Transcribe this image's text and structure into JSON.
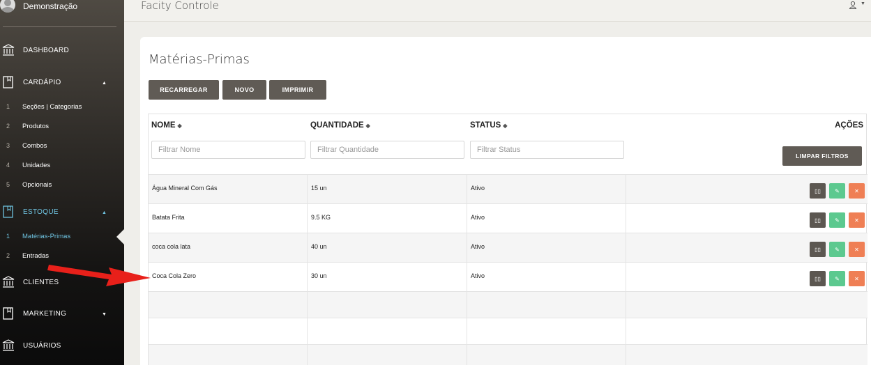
{
  "profile": {
    "name": "Demonstração"
  },
  "topbar": {
    "title": "Facity Controle",
    "user_icon": "user-icon"
  },
  "sidebar": {
    "items": [
      {
        "label": "DASHBOARD",
        "icon": "bank-icon"
      },
      {
        "label": "CARDÁPIO",
        "icon": "book-icon",
        "caret": "▲"
      },
      {
        "label": "ESTOQUE",
        "icon": "book-icon",
        "caret": "▲"
      },
      {
        "label": "CLIENTES",
        "icon": "bank-icon"
      },
      {
        "label": "MARKETING",
        "icon": "book-icon",
        "caret": "▼"
      },
      {
        "label": "USUÁRIOS",
        "icon": "bank-icon"
      }
    ],
    "cardapio_sub": [
      {
        "num": "1",
        "label": "Seções | Categorias"
      },
      {
        "num": "2",
        "label": "Produtos"
      },
      {
        "num": "3",
        "label": "Combos"
      },
      {
        "num": "4",
        "label": "Unidades"
      },
      {
        "num": "5",
        "label": "Opcionais"
      }
    ],
    "estoque_sub": [
      {
        "num": "1",
        "label": "Matérias-Primas"
      },
      {
        "num": "2",
        "label": "Entradas"
      }
    ],
    "active_color": "#6ec2df"
  },
  "page": {
    "title": "Matérias-Primas",
    "buttons": {
      "reload": "RECARREGAR",
      "new": "NOVO",
      "print": "IMPRIMIR"
    }
  },
  "table": {
    "headers": {
      "name": "NOME",
      "quantity": "QUANTIDADE",
      "status": "STATUS",
      "actions": "AÇÕES"
    },
    "filters": {
      "name_placeholder": "Filtrar Nome",
      "quantity_placeholder": "Filtrar Quantidade",
      "status_placeholder": "Filtrar Status",
      "clear_label": "LIMPAR FILTROS"
    },
    "rows": [
      {
        "name": "Água Mineral Com Gás",
        "quantity": "15 un",
        "status": "Ativo"
      },
      {
        "name": "Batata Frita",
        "quantity": "9.5 KG",
        "status": "Ativo"
      },
      {
        "name": "coca cola lata",
        "quantity": "40 un",
        "status": "Ativo"
      },
      {
        "name": "Coca Cola Zero",
        "quantity": "30 un",
        "status": "Ativo"
      }
    ],
    "action_icons": {
      "view": "columns-icon",
      "edit": "edit-icon",
      "delete": "close-icon"
    },
    "colors": {
      "view": "#5c5751",
      "edit": "#5cc98f",
      "delete": "#ef7f55"
    }
  },
  "annotation": {
    "arrow_color": "#e8201a"
  }
}
